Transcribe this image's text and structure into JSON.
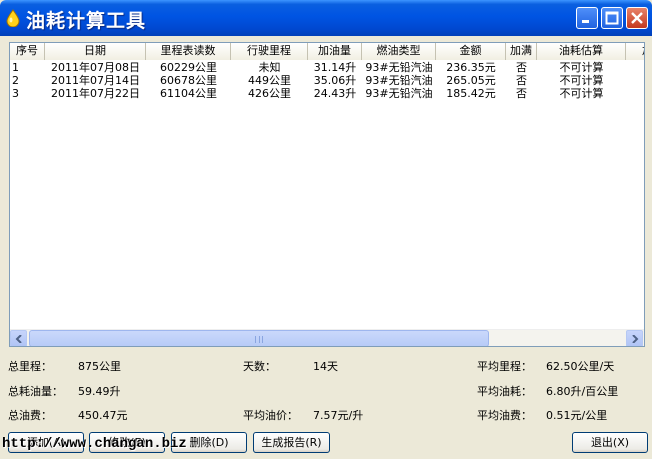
{
  "window": {
    "title": "油耗计算工具"
  },
  "list": {
    "columns": [
      "序号",
      "日期",
      "里程表读数",
      "行驶里程",
      "加油量",
      "燃油类型",
      "金额",
      "加满",
      "油耗估算",
      "加"
    ],
    "rows": [
      [
        "1",
        "2011年07月08日",
        "60229公里",
        "未知",
        "31.14升",
        "93#无铅汽油",
        "236.35元",
        "否",
        "不可计算"
      ],
      [
        "2",
        "2011年07月14日",
        "60678公里",
        "449公里",
        "35.06升",
        "93#无铅汽油",
        "265.05元",
        "否",
        "不可计算"
      ],
      [
        "3",
        "2011年07月22日",
        "61104公里",
        "426公里",
        "24.43升",
        "93#无铅汽油",
        "185.42元",
        "否",
        "不可计算"
      ]
    ]
  },
  "stats": {
    "total_mileage_label": "总里程：",
    "total_mileage_value": "875公里",
    "days_label": "天数：",
    "days_value": "14天",
    "avg_mileage_label": "平均里程：",
    "avg_mileage_value": "62.50公里/天",
    "total_fuel_label": "总耗油量：",
    "total_fuel_value": "59.49升",
    "avg_consumption_label": "平均油耗：",
    "avg_consumption_value": "6.80升/百公里",
    "total_cost_label": "总油费：",
    "total_cost_value": "450.47元",
    "avg_price_label": "平均油价：",
    "avg_price_value": "7.57元/升",
    "avg_cost_label": "平均油费：",
    "avg_cost_value": "0.51元/公里"
  },
  "buttons": {
    "add": "添加(A)",
    "edit": "修改(E)",
    "delete": "删除(D)",
    "report": "生成报告(R)",
    "exit": "退出(X)"
  },
  "watermark": "http://www.changan.biz",
  "colors": {
    "titlebar": "#0054e3",
    "close_button": "#c4391f",
    "window_bg": "#ece9d8"
  }
}
